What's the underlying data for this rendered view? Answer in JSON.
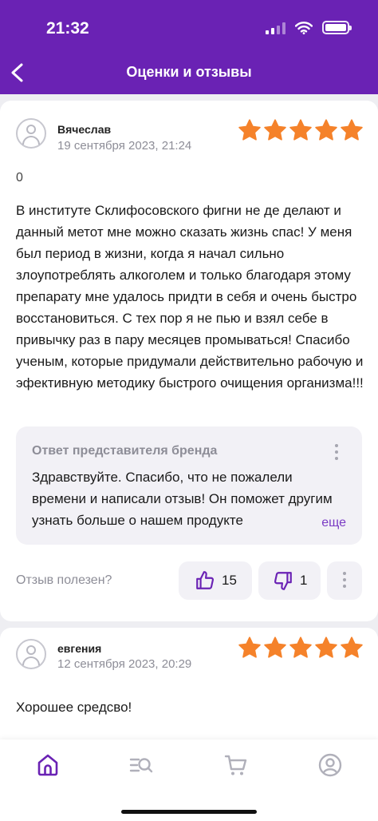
{
  "status_bar": {
    "time": "21:32"
  },
  "header": {
    "title": "Оценки и отзывы"
  },
  "colors": {
    "brand": "#6a22b4",
    "star": "#f5822a",
    "accent_link": "#7a3bc4"
  },
  "reviews": [
    {
      "author": "Вячеслав",
      "date": "19 сентября 2023, 21:24",
      "rating": 5,
      "extra_line": "0",
      "text": "В институте Склифосовского фигни не де делают и данный метот мне можно сказать жизнь спас! У меня был период в жизни, когда я начал сильно злоупотреблять алкоголем и только благодаря этому препарату мне удалось придти в себя и очень быстро восстановиться. С тех пор я не пью и взял себе в привычку раз в пару месяцев промываться! Спасибо ученым, которые придумали действительно рабочую и эфективную методику быстрого очищения организма!!!",
      "brand_reply": {
        "title": "Ответ представителя бренда",
        "text": "Здравствуйте. Спасибо, что не пожалели времени и написали отзыв! Он поможет другим узнать больше о нашем продукте",
        "more_label": "еще"
      },
      "helpful_label": "Отзыв полезен?",
      "likes": "15",
      "dislikes": "1"
    },
    {
      "author": "евгения",
      "date": "12 сентября 2023, 20:29",
      "rating": 5,
      "text": "Хорошее средсво!"
    }
  ],
  "tab_bar": {
    "icons": [
      "home-icon",
      "catalog-search-icon",
      "cart-icon",
      "profile-icon"
    ],
    "active": "home-icon"
  }
}
